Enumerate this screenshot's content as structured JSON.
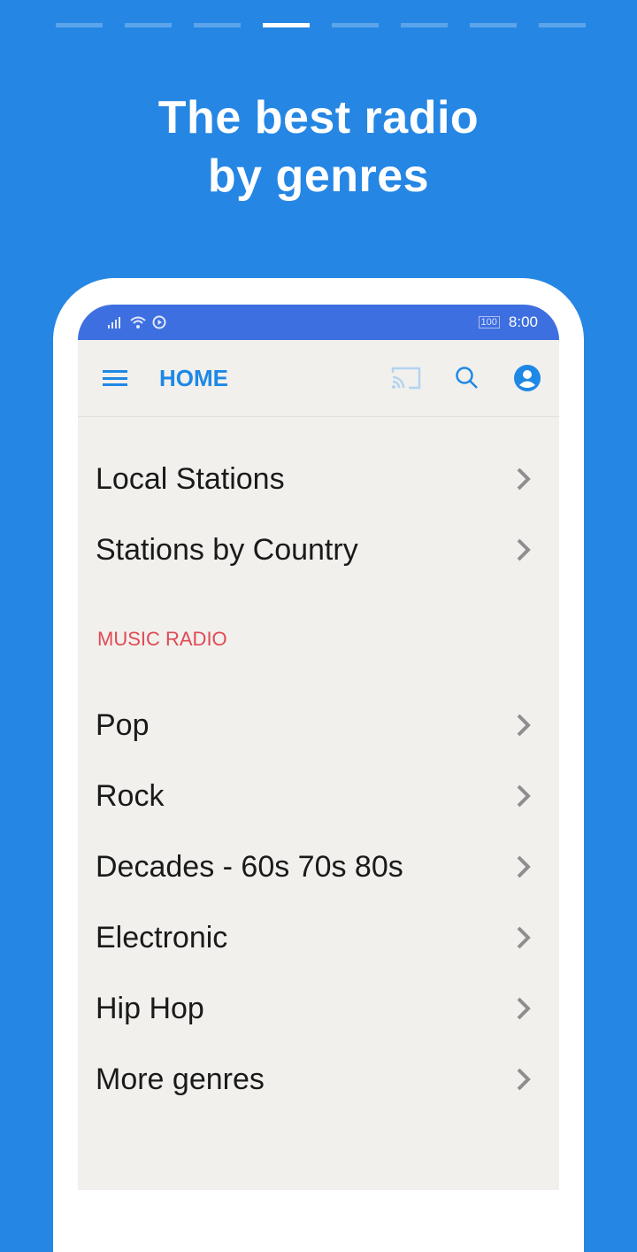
{
  "pager": {
    "count": 8,
    "active_index": 3
  },
  "headline": {
    "line1": "The best radio",
    "line2": "by genres"
  },
  "status_bar": {
    "battery": "100",
    "time": "8:00"
  },
  "toolbar": {
    "title": "HOME",
    "icons": [
      "menu-icon",
      "cast-icon",
      "search-icon",
      "account-icon"
    ]
  },
  "top_items": [
    {
      "label": "Local Stations"
    },
    {
      "label": "Stations by Country"
    }
  ],
  "section_header": "MUSIC RADIO",
  "genre_items": [
    {
      "label": "Pop"
    },
    {
      "label": "Rock"
    },
    {
      "label": "Decades - 60s 70s 80s"
    },
    {
      "label": "Electronic"
    },
    {
      "label": "Hip Hop"
    },
    {
      "label": "More genres"
    }
  ],
  "colors": {
    "background": "#2586e4",
    "accent": "#1e88e5",
    "section": "#e04a55",
    "status_bar": "#3e6fe0"
  }
}
